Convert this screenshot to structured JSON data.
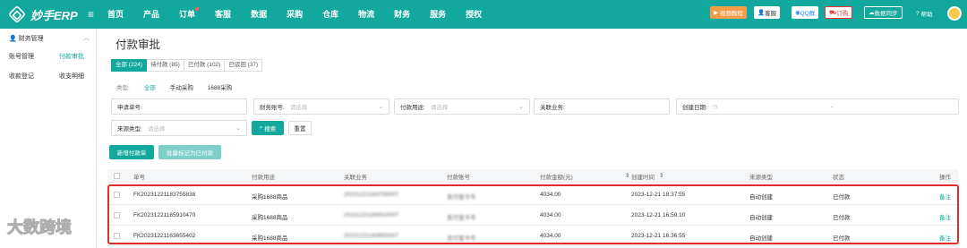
{
  "topbar": {
    "logo_text": "妙手ERP",
    "nav": [
      "首页",
      "产品",
      "订单",
      "客服",
      "数据",
      "采购",
      "仓库",
      "物流",
      "财务",
      "服务",
      "授权"
    ],
    "video_tutorial": "视频教程",
    "user_label": "客服",
    "qq_label": "QQ群",
    "order_label": "订购",
    "sync_label": "数据同步",
    "help_label": "帮助"
  },
  "sidebar": {
    "header": "财务管理",
    "items": [
      "账号管理",
      "付款审批",
      "收款登记",
      "收支明细"
    ]
  },
  "page": {
    "title": "付款审批",
    "tabs": [
      "全部 (224)",
      "待付款 (85)",
      "已付款 (102)",
      "已驳回 (37)"
    ],
    "type_label": "类型:",
    "types": [
      "全部",
      "手动采购",
      "1688采购"
    ],
    "filters": {
      "apply_no": "申请单号:",
      "account_label": "财务账号:",
      "account_placeholder": "请选择",
      "purpose_label": "付款用途:",
      "purpose_placeholder": "请选择",
      "biz_label": "关联业务:",
      "date_label": "创建日期:",
      "date_sep": "-",
      "source_label": "来源类型:",
      "source_placeholder": "请选择",
      "search_btn": "搜索",
      "reset_btn": "重置"
    },
    "actions": {
      "new_btn": "新增付款单",
      "batch_btn": "批量标记为已付款"
    }
  },
  "table": {
    "headers": [
      "单号",
      "付款用途",
      "关联业务",
      "付款账号",
      "付款金额(元)",
      "创建时间",
      "来源类型",
      "状态",
      "操作"
    ],
    "rows": [
      {
        "no": "FK20231221183755838",
        "purpose": "采购1688商品",
        "biz": "20231221183755007",
        "account": "支付宝卡号",
        "amount": "4034.00",
        "time": "2023-12-21 18:37:55",
        "source": "自动创建",
        "status": "已付款",
        "op": "备注"
      },
      {
        "no": "FK20231221165910470",
        "purpose": "采购1688商品",
        "biz": "20231221165910007",
        "account": "支付宝卡号",
        "amount": "4034.00",
        "time": "2023-12-21 16:59:10",
        "source": "自动创建",
        "status": "已付款",
        "op": "备注"
      },
      {
        "no": "FK20231221163655402",
        "purpose": "采购1688商品",
        "biz": "20231221163655007",
        "account": "支付宝卡号",
        "amount": "4034.00",
        "time": "2023-12-21 16:36:55",
        "source": "自动创建",
        "status": "已付款",
        "op": "备注"
      }
    ]
  },
  "watermark": "大数跨境"
}
